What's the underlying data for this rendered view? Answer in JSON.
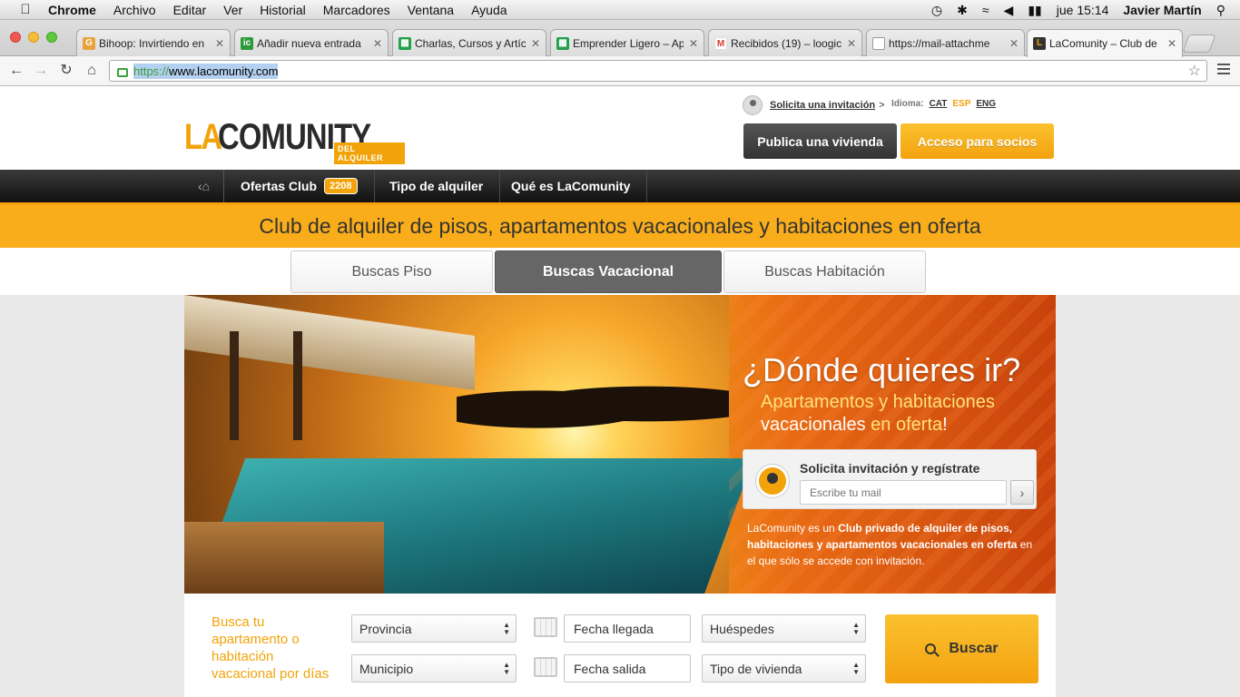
{
  "menubar": {
    "app": "Chrome",
    "items": [
      "Archivo",
      "Editar",
      "Ver",
      "Historial",
      "Marcadores",
      "Ventana",
      "Ayuda"
    ],
    "clock": "jue 15:14",
    "user": "Javier Martín"
  },
  "tabs": [
    {
      "title": "Bihoop: Invirtiendo en",
      "icon": "chrome-icon",
      "color": "#e8a33b"
    },
    {
      "title": "Añadir nueva entrada",
      "icon": "ic-icon",
      "color": "#2a9a3a"
    },
    {
      "title": "Charlas, Cursos y Artíc",
      "icon": "sheets-icon",
      "color": "#22a04a"
    },
    {
      "title": "Emprender Ligero – Ap",
      "icon": "sheets-icon",
      "color": "#22a04a"
    },
    {
      "title": "Recibidos (19) – loogic",
      "icon": "gmail-icon",
      "color": "#d33b2c"
    },
    {
      "title": "https://mail-attachme",
      "icon": "document-icon",
      "color": "#999999"
    },
    {
      "title": "LaComunity – Club de",
      "icon": "lacomunity-icon",
      "color": "#f2a30a"
    }
  ],
  "address": {
    "https": "https://",
    "host": "www.lacomunity.com"
  },
  "header": {
    "logo_la": "LA",
    "logo_comunity": "COMUNITY",
    "logo_sub": "DEL ALQUILER",
    "invite_link": "Solicita una invitación",
    "invite_arrow": ">",
    "lang_label": "Idioma:",
    "langs": [
      "CAT",
      "ESP",
      "ENG"
    ],
    "publish_btn": "Publica una vivienda",
    "access_btn": "Acceso para socios"
  },
  "nav": {
    "offers": "Ofertas Club",
    "offers_count": "2208",
    "type": "Tipo de alquiler",
    "about": "Qué es LaComunity"
  },
  "banner": {
    "text": "Club de alquiler de pisos, apartamentos vacacionales y habitaciones en oferta"
  },
  "search_tabs": [
    "Buscas Piso",
    "Buscas Vacacional",
    "Buscas Habitación"
  ],
  "hero": {
    "title": "¿Dónde quieres ir?",
    "sub1": "Apartamentos y habitaciones",
    "sub2a": "vacacionales",
    "sub2b": " en oferta",
    "sub2c": "!",
    "invite_title": "Solicita invitación y regístrate",
    "email_placeholder": "Escribe tu mail",
    "desc_a": "LaComunity es un ",
    "desc_b": "Club privado de alquiler de pisos, habitaciones y apartamentos vacacionales en oferta",
    "desc_c": " en el que sólo se accede con invitación."
  },
  "search": {
    "lead": "Busca tu apartamento o habitación vacacional por días",
    "provincia": "Provincia",
    "municipio": "Municipio",
    "fecha_llegada": "Fecha llegada",
    "fecha_salida": "Fecha salida",
    "huespedes": "Huéspedes",
    "tipo": "Tipo de vivienda",
    "button": "Buscar"
  },
  "colors": {
    "accent": "#f2a30a",
    "banner": "#f9ad1a",
    "dark_button": "#444444"
  }
}
